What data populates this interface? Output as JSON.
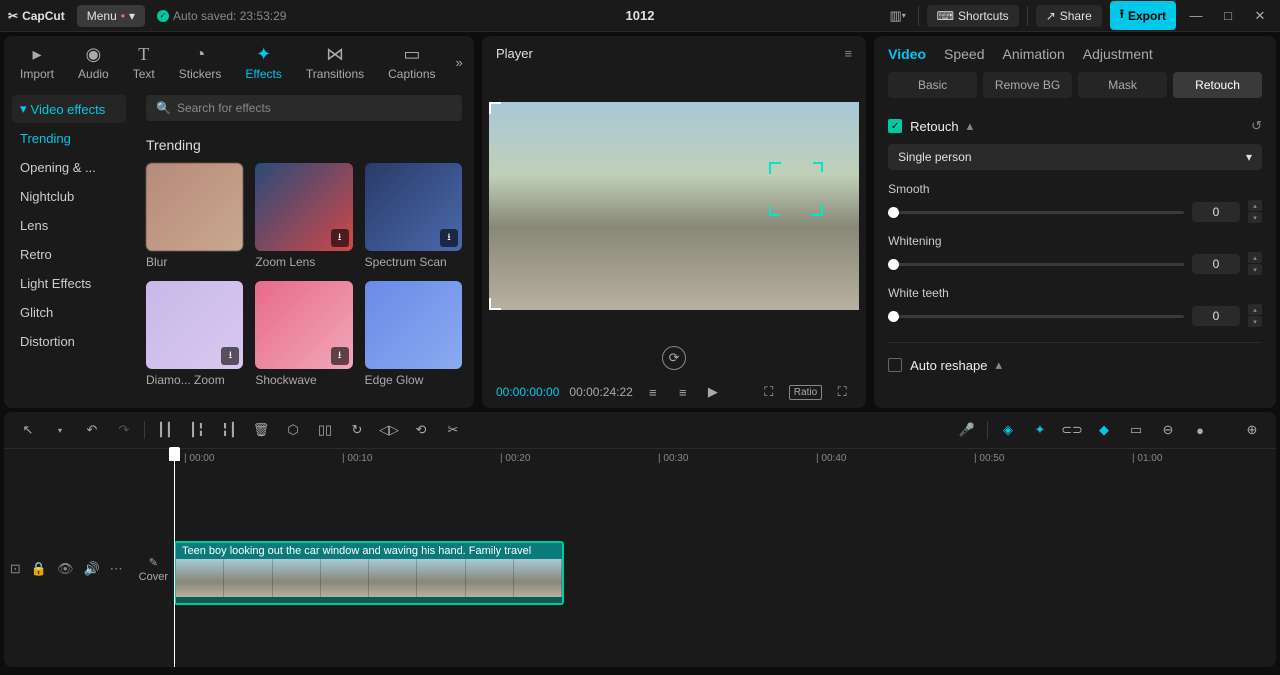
{
  "topbar": {
    "logo": "CapCut",
    "menu": "Menu",
    "autosave": "Auto saved: 23:53:29",
    "title": "1012",
    "shortcuts": "Shortcuts",
    "share": "Share",
    "export": "Export"
  },
  "leftTabs": [
    "Import",
    "Audio",
    "Text",
    "Stickers",
    "Effects",
    "Transitions",
    "Captions"
  ],
  "sidebar": {
    "header": "Video effects",
    "items": [
      "Trending",
      "Opening & ...",
      "Nightclub",
      "Lens",
      "Retro",
      "Light Effects",
      "Glitch",
      "Distortion"
    ]
  },
  "effects": {
    "searchPlaceholder": "Search for effects",
    "sectionTitle": "Trending",
    "cards": [
      "Blur",
      "Zoom Lens",
      "Spectrum Scan",
      "Diamo... Zoom",
      "Shockwave",
      "Edge Glow"
    ]
  },
  "player": {
    "title": "Player",
    "current": "00:00:00:00",
    "duration": "00:00:24:22",
    "ratio": "Ratio"
  },
  "props": {
    "tabs": [
      "Video",
      "Speed",
      "Animation",
      "Adjustment"
    ],
    "subTabs": [
      "Basic",
      "Remove BG",
      "Mask",
      "Retouch"
    ],
    "retouch": "Retouch",
    "dropdown": "Single person",
    "sliders": [
      {
        "label": "Smooth",
        "value": "0"
      },
      {
        "label": "Whitening",
        "value": "0"
      },
      {
        "label": "White teeth",
        "value": "0"
      }
    ],
    "autoReshape": "Auto reshape"
  },
  "timeline": {
    "ticks": [
      "00:00",
      "00:10",
      "00:20",
      "00:30",
      "00:40",
      "00:50",
      "01:00"
    ],
    "cover": "Cover",
    "clipCaption": "Teen boy looking out the car window and waving his hand. Family travel"
  }
}
